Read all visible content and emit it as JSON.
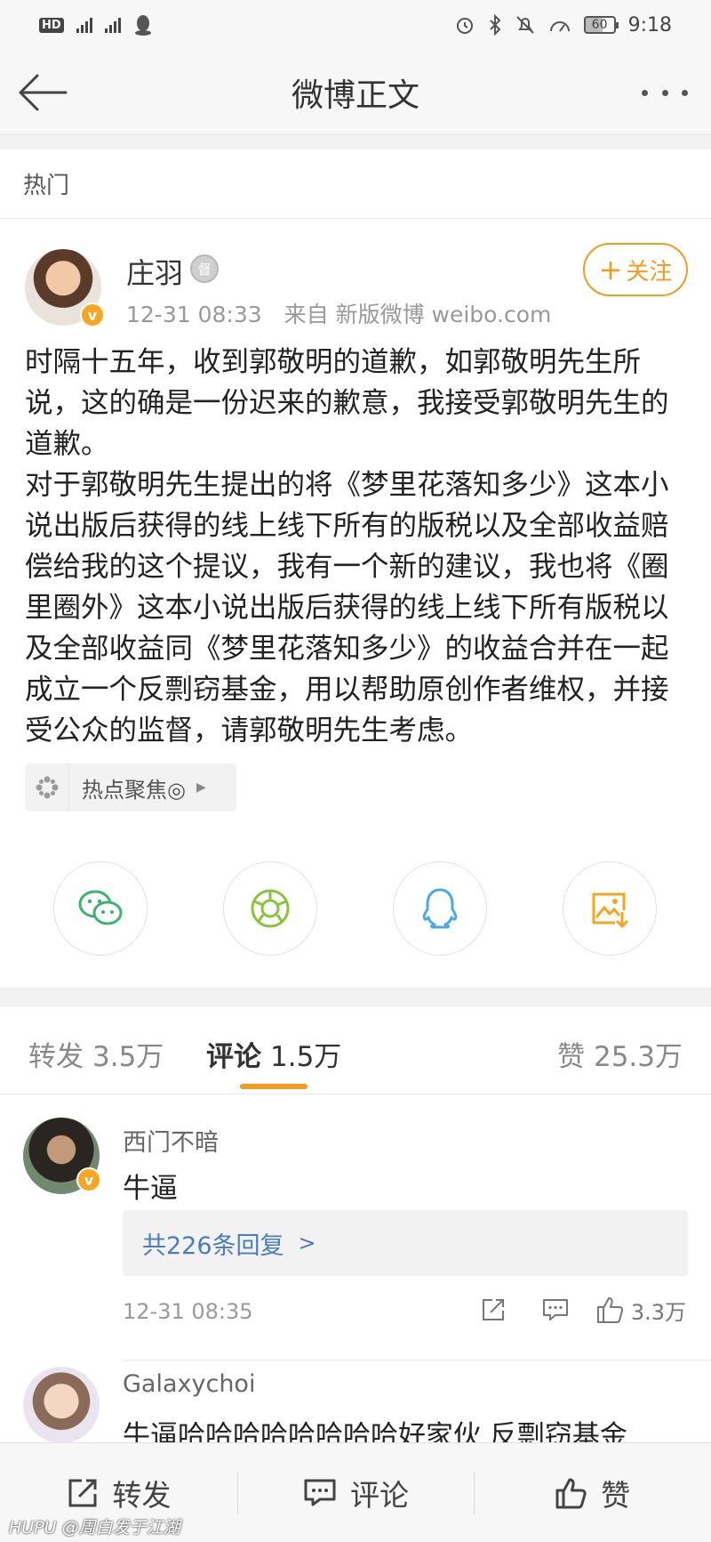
{
  "status_bar": {
    "left_indicators": [
      "HD",
      "2G",
      "4G"
    ],
    "battery": "60",
    "time": "9:18"
  },
  "nav": {
    "title": "微博正文"
  },
  "section_label": "热门",
  "post": {
    "author": "庄羽",
    "medal_glyph": "督",
    "meta": "12-31 08:33　来自 新版微博 weibo.com",
    "follow_label": "关注",
    "follow_plus": "+",
    "verified_glyph": "v",
    "paragraphs": [
      "时隔十五年，收到郭敬明的道歉，如郭敬明先生所说，这的确是一份迟来的歉意，我接受郭敬明先生的道歉。",
      "对于郭敬明先生提出的将《梦里花落知多少》这本小说出版后获得的线上线下所有的版税以及全部收益赔偿给我的这个提议，我有一个新的建议，我也将《圈里圈外》这本小说出版后获得的线上线下所有版税以及全部收益同《梦里花落知多少》的收益合并在一起成立一个反剽窃基金，用以帮助原创作者维权，并接受公众的监督，请郭敬明先生考虑。"
    ],
    "topic_tag": "热点聚焦◎"
  },
  "share_icons": [
    "wechat-icon",
    "moments-icon",
    "qq-icon",
    "save-image-icon"
  ],
  "tabs": [
    {
      "label": "转发",
      "count": "3.5万"
    },
    {
      "label": "评论",
      "count": "1.5万"
    },
    {
      "label": "赞",
      "count": "25.3万"
    }
  ],
  "comments": [
    {
      "name": "西门不暗",
      "text": "牛逼",
      "replies": "共226条回复",
      "time": "12-31 08:35",
      "likes": "3.3万"
    },
    {
      "name": "Galaxychoi",
      "text": "牛逼哈哈哈哈哈哈哈哈好家伙 反剽窃基金"
    }
  ],
  "bottom_bar": {
    "repost": "转发",
    "comment": "评论",
    "like": "赞"
  },
  "watermark": "HUPU @周白发于江湖",
  "colors": {
    "accent": "#f39b1f",
    "link": "#4a7dbb",
    "wechat": "#3cb371",
    "moments": "#8ac43f",
    "qq": "#4aa8e8",
    "save": "#f3a51d"
  }
}
